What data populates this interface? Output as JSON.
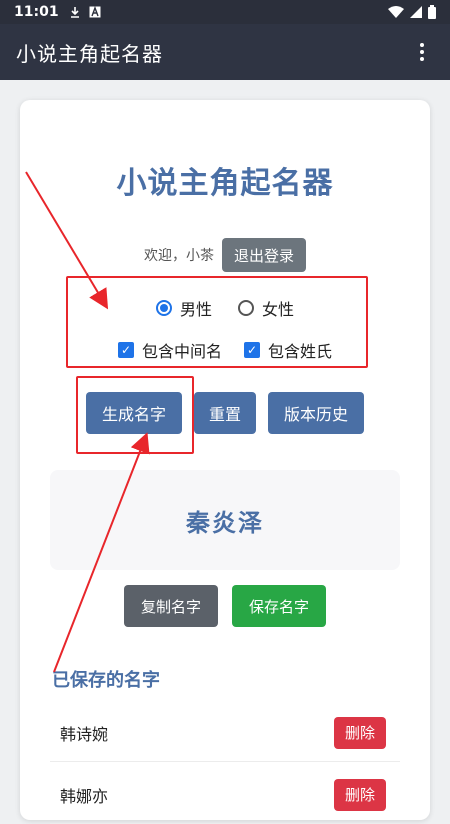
{
  "status_bar": {
    "time": "11:01"
  },
  "app_bar": {
    "title": "小说主角起名器"
  },
  "page": {
    "title": "小说主角起名器",
    "welcome": "欢迎，小茶",
    "logout_label": "退出登录"
  },
  "gender_options": [
    {
      "label": "男性",
      "checked": true
    },
    {
      "label": "女性",
      "checked": false
    }
  ],
  "checkbox_options": [
    {
      "label": "包含中间名",
      "checked": true
    },
    {
      "label": "包含姓氏",
      "checked": true
    }
  ],
  "buttons": {
    "generate": "生成名字",
    "reset": "重置",
    "history": "版本历史",
    "copy": "复制名字",
    "save": "保存名字"
  },
  "result": {
    "name": "秦炎泽"
  },
  "saved": {
    "title": "已保存的名字",
    "delete_label": "删除",
    "items": [
      "韩诗婉",
      "韩娜亦"
    ]
  },
  "colors": {
    "accent": "#4a6fa5",
    "annotation": "#e8262b",
    "save": "#28a745",
    "delete": "#dc3545"
  }
}
